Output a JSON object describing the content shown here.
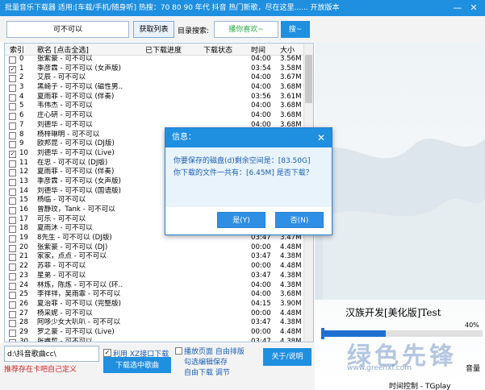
{
  "window": {
    "title": "批量音乐下载器  适用:[车载/手机/随身听]  热搜：70 80 90 年代 抖音 热门新歌，尽在这里...... 开放版本",
    "minimize": "—",
    "close": "✕"
  },
  "search": {
    "value": "可不可以",
    "fetch_button": "获取列表",
    "dir_label": "目录搜索:",
    "dir_value": "播你喜欢~",
    "search_button": "搜~"
  },
  "list": {
    "headers": {
      "index": "索引",
      "name": "歌名 [点击全选]",
      "downloaded": "已下载进度",
      "status": "下载状态",
      "time": "时间",
      "size": "大小"
    },
    "rows": [
      {
        "idx": "0",
        "name": "张紫豪 - 可不可以",
        "time": "04:00",
        "size": "3.56M",
        "checked": false
      },
      {
        "idx": "1",
        "name": "季彦霖 - 可不可以 (女声版)",
        "time": "03:54",
        "size": "3.58M",
        "checked": true
      },
      {
        "idx": "2",
        "name": "艾辰 - 可不可以",
        "time": "04:00",
        "size": "3.67M",
        "checked": false
      },
      {
        "idx": "3",
        "name": "黑崎子 - 可不可以 (磁性男..",
        "time": "04:00",
        "size": "3.68M",
        "checked": false
      },
      {
        "idx": "4",
        "name": "夏雨菲 - 可不可以 (伴奏)",
        "time": "03:56",
        "size": "3.61M",
        "checked": false
      },
      {
        "idx": "5",
        "name": "韦伟杰 - 可不可以",
        "time": "04:00",
        "size": "3.68M",
        "checked": false
      },
      {
        "idx": "6",
        "name": "庄心研 - 可不可以",
        "time": "04:00",
        "size": "3.68M",
        "checked": false
      },
      {
        "idx": "7",
        "name": "刘德华 - 可不可以",
        "time": "04:00",
        "size": "3.68M",
        "checked": false
      },
      {
        "idx": "8",
        "name": "杨梓琳明 - 可不可以",
        "time": "04:00",
        "size": "3.68M",
        "checked": false
      },
      {
        "idx": "9",
        "name": "欧邦昆 - 可不可以 (DJ版)",
        "time": "04:00",
        "size": "3.68M",
        "checked": false
      },
      {
        "idx": "10",
        "name": "刘德华 - 可不可以 (Live)",
        "time": "04:00",
        "size": "3.68M",
        "checked": true
      },
      {
        "idx": "11",
        "name": "在忠 - 可不可以 (DJ版)",
        "time": "04:00",
        "size": "3.68M",
        "checked": false
      },
      {
        "idx": "12",
        "name": "夏雨菲 - 可不可以 (伴奏)",
        "time": "04:00",
        "size": "3.68M",
        "checked": false
      },
      {
        "idx": "13",
        "name": "季彦霖 - 可不可以 (女声版)",
        "time": "04:00",
        "size": "3.68M",
        "checked": false
      },
      {
        "idx": "14",
        "name": "刘德华 - 可不可以 (国语版)",
        "time": "04:00",
        "size": "3.68M",
        "checked": false
      },
      {
        "idx": "15",
        "name": "杨临 - 可不可以",
        "time": "04:00",
        "size": "3.68M",
        "checked": false
      },
      {
        "idx": "16",
        "name": "曾静玟，Tank - 可不可以",
        "time": "04:00",
        "size": "3.68M",
        "checked": false
      },
      {
        "idx": "17",
        "name": "可乐 - 可不可以",
        "time": "04:00",
        "size": "3.68M",
        "checked": false
      },
      {
        "idx": "18",
        "name": "夏雨沐 - 可不可以",
        "time": "04:00",
        "size": "3.68M",
        "checked": false
      },
      {
        "idx": "19",
        "name": "8先生 - 可不可以 (DJ版)",
        "time": "03:47",
        "size": "3.47M",
        "checked": false
      },
      {
        "idx": "20",
        "name": "张紫豪 - 可不可以 (DJ)",
        "time": "00:00",
        "size": "4.48M",
        "checked": false
      },
      {
        "idx": "21",
        "name": "家家，点点 - 可不可以",
        "time": "03:47",
        "size": "4.38M",
        "checked": false
      },
      {
        "idx": "22",
        "name": "苏菲 - 可不可以",
        "time": "00:00",
        "size": "4.48M",
        "checked": false
      },
      {
        "idx": "23",
        "name": "星弟 - 可不可以",
        "time": "03:47",
        "size": "4.38M",
        "checked": false
      },
      {
        "idx": "24",
        "name": "林炼，陈炼 - 可不可以 (环..",
        "time": "04:00",
        "size": "4.38M",
        "checked": false
      },
      {
        "idx": "25",
        "name": "李祥祥，吴雨霏 - 可不可以",
        "time": "04:00",
        "size": "3.68M",
        "checked": false
      },
      {
        "idx": "26",
        "name": "夏治菲 - 可不可以 (完整版)",
        "time": "04:15",
        "size": "3.90M",
        "checked": false
      },
      {
        "idx": "27",
        "name": "杨采妮 - 可不可以",
        "time": "00:00",
        "size": "4.48M",
        "checked": false
      },
      {
        "idx": "28",
        "name": "阿哆少女大叭叭 - 可不可以",
        "time": "03:47",
        "size": "4.38M",
        "checked": false
      },
      {
        "idx": "29",
        "name": "罗之豪 - 可不可以 (Live)",
        "time": "00:00",
        "size": "4.48M",
        "checked": false
      },
      {
        "idx": "30",
        "name": "张睿哲 - 可不可以",
        "time": "03:47",
        "size": "4.38M",
        "checked": false
      },
      {
        "idx": "31",
        "name": "胡66 - 可不可以 (Live)",
        "time": "00:00",
        "size": "4.48M",
        "checked": false
      }
    ]
  },
  "bottom": {
    "path": "d:\\抖音歌曲cc\\",
    "xz_label": "利用 XZ接口下载",
    "download_button": "下载选中歌曲",
    "option1": "播放页面 自由排版",
    "option2": "勾选编辑保存",
    "option3": "自由下载 调节",
    "about_button": "关于/说明",
    "hint": "推荐存在卡吧自己定义"
  },
  "player": {
    "brand": "汉族开发[美化版]Test",
    "progress_label": "40%",
    "progress": 0.4,
    "watermark": "绿色先锋",
    "site": "www.greenxf.com",
    "volume_label": "音量",
    "time_label": "时间控制 - TGplay"
  },
  "dialog": {
    "title": "信息：",
    "close": "✕",
    "message_line1": "你要保存的磁盘(d)剩余空间是：[83.50G]",
    "message_line2": "你下载的文件一共有：[6.45M] 是否下载？",
    "yes": "是(Y)",
    "no": "否(N)"
  }
}
